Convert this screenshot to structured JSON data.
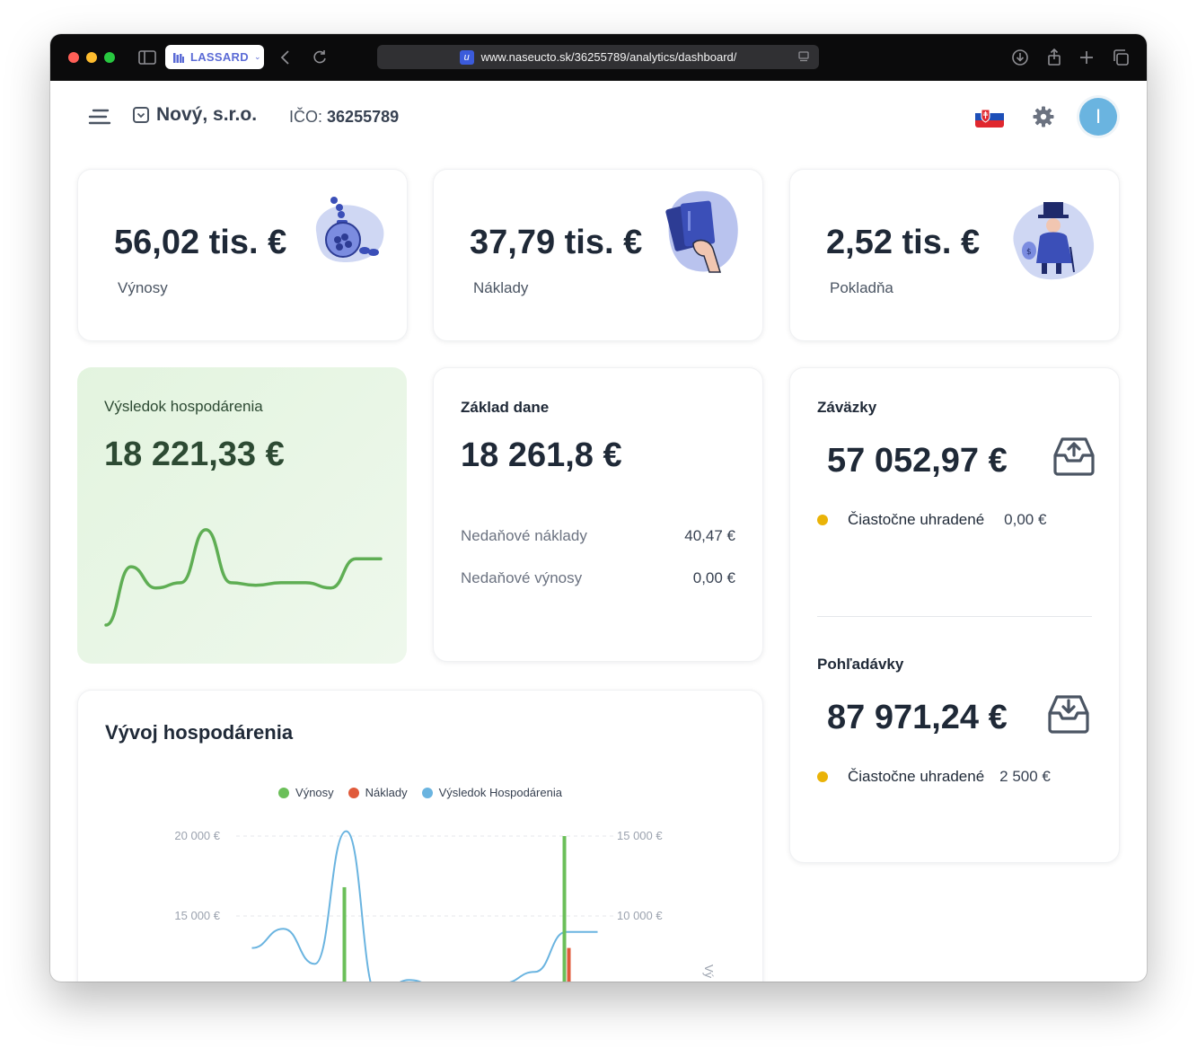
{
  "browser": {
    "tab_label": "LASSARD",
    "url": "www.naseucto.sk/36255789/analytics/dashboard/"
  },
  "header": {
    "company_name": "Nový, s.r.o.",
    "ico_label": "IČO:",
    "ico_value": "36255789",
    "avatar_initial": "I"
  },
  "kpis": [
    {
      "value": "56,02 tis. €",
      "label": "Výnosy"
    },
    {
      "value": "37,79 tis. €",
      "label": "Náklady"
    },
    {
      "value": "2,52 tis. €",
      "label": "Pokladňa"
    }
  ],
  "result": {
    "title": "Výsledok hospodárenia",
    "value": "18 221,33 €",
    "sparkline": [
      -0.95,
      0.15,
      -0.25,
      -0.15,
      0.85,
      -0.15,
      -0.2,
      -0.15,
      -0.15,
      -0.25,
      0.3,
      0.3
    ]
  },
  "tax": {
    "title": "Základ dane",
    "value": "18 261,8 €",
    "rows": [
      {
        "label": "Nedaňové náklady",
        "value": "40,47 €"
      },
      {
        "label": "Nedaňové výnosy",
        "value": "0,00 €"
      }
    ]
  },
  "liabilities": {
    "title": "Záväzky",
    "value": "57 052,97 €",
    "status_label": "Čiastočne uhradené",
    "status_value": "0,00 €"
  },
  "receivables": {
    "title": "Pohľadávky",
    "value": "87 971,24 €",
    "status_label": "Čiastočne uhradené",
    "status_value": "2 500 €"
  },
  "colors": {
    "accent_green": "#6bbf59",
    "accent_red": "#e05a3a",
    "accent_blue": "#6ab4e0",
    "status_yellow": "#eab308"
  },
  "chart_data": {
    "type": "bar",
    "title": "Vývoj hospodárenia",
    "legend": [
      {
        "name": "Výnosy",
        "color": "#6bbf59"
      },
      {
        "name": "Náklady",
        "color": "#e05a3a"
      },
      {
        "name": "Výsledok Hospodárenia",
        "color": "#6ab4e0"
      }
    ],
    "y_left_ticks": [
      "20 000 €",
      "15 000 €"
    ],
    "y_right_ticks": [
      "15 000 €",
      "10 000 €"
    ],
    "y_left_range": [
      15000,
      20000
    ],
    "y_right_range": [
      10000,
      15000
    ],
    "right_axis_label": "Vý",
    "x_count": 12,
    "series": [
      {
        "name": "Výnosy",
        "axis": "left",
        "values": [
          null,
          null,
          null,
          16800,
          null,
          null,
          null,
          null,
          null,
          null,
          20000,
          null
        ]
      },
      {
        "name": "Náklady",
        "axis": "left",
        "values": [
          null,
          null,
          null,
          null,
          null,
          null,
          null,
          null,
          null,
          null,
          13000,
          null
        ]
      },
      {
        "name": "Výsledok Hospodárenia",
        "axis": "right",
        "values": [
          8000,
          9200,
          7000,
          15300,
          5000,
          6000,
          5500,
          5800,
          5800,
          6500,
          9000,
          9000
        ]
      }
    ]
  }
}
